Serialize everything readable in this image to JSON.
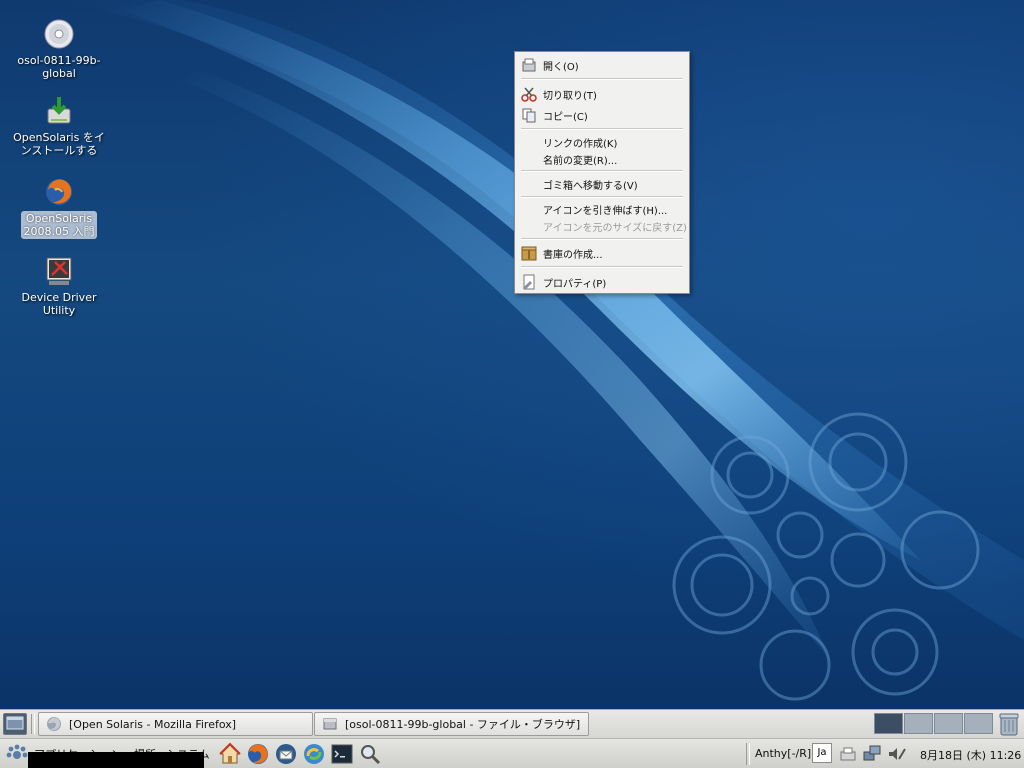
{
  "desktop_icons": [
    {
      "label": "osol-0811-99b-\nglobal",
      "line1": "osol-0811-99b-",
      "line2": "global",
      "icon": "cd-disc-icon"
    },
    {
      "label": "OpenSolaris をインストールする",
      "line1": "OpenSolaris をイ",
      "line2": "ンストールする",
      "icon": "install-icon"
    },
    {
      "label": "OpenSolaris 2008.05 入門",
      "line1": "OpenSolaris",
      "line2": "2008.05 入門",
      "icon": "firefox-icon",
      "selected": true
    },
    {
      "label": "Device Driver Utility",
      "line1": "Device Driver",
      "line2": "Utility",
      "icon": "device-driver-icon"
    }
  ],
  "context_menu": {
    "items": [
      {
        "label": "開く(O)",
        "icon": "open-icon",
        "disabled": false
      },
      {
        "label": "切り取り(T)",
        "icon": "scissors-icon",
        "disabled": false
      },
      {
        "label": "コピー(C)",
        "icon": "copy-icon",
        "disabled": false
      },
      {
        "label": "リンクの作成(K)",
        "icon": "",
        "disabled": false
      },
      {
        "label": "名前の変更(R)...",
        "icon": "",
        "disabled": false
      },
      {
        "label": "ゴミ箱へ移動する(V)",
        "icon": "",
        "disabled": false
      },
      {
        "label": "アイコンを引き伸ばす(H)...",
        "icon": "",
        "disabled": false
      },
      {
        "label": "アイコンを元のサイズに戻す(Z)",
        "icon": "",
        "disabled": true
      },
      {
        "label": "書庫の作成...",
        "icon": "archive-icon",
        "disabled": false
      },
      {
        "label": "プロパティ(P)",
        "icon": "properties-icon",
        "disabled": false
      }
    ]
  },
  "taskbar": {
    "tasks": [
      {
        "label": "[Open Solaris - Mozilla Firefox]",
        "icon": "firefox-icon"
      },
      {
        "label": "[osol-0811-99b-global - ファイル・ブラウザ]",
        "icon": "file-browser-icon"
      }
    ],
    "workspaces": 4,
    "active_workspace": 1
  },
  "main_panel": {
    "menus": [
      "アプリケーション",
      "場所",
      "システム"
    ],
    "launchers": [
      "home-icon",
      "firefox-icon",
      "thunderbird-icon",
      "update-icon",
      "terminal-icon",
      "search-icon"
    ],
    "ime_status": "Anthy[-/R]",
    "ime_lang": "Ja",
    "clock": "8月18日 (木) 11:26"
  },
  "colors": {
    "desktop_bg": "#0f3a70",
    "panel_bg": "#dcdcd9",
    "menu_bg": "#f1f1ef",
    "active_workspace": "#3b4e63"
  }
}
